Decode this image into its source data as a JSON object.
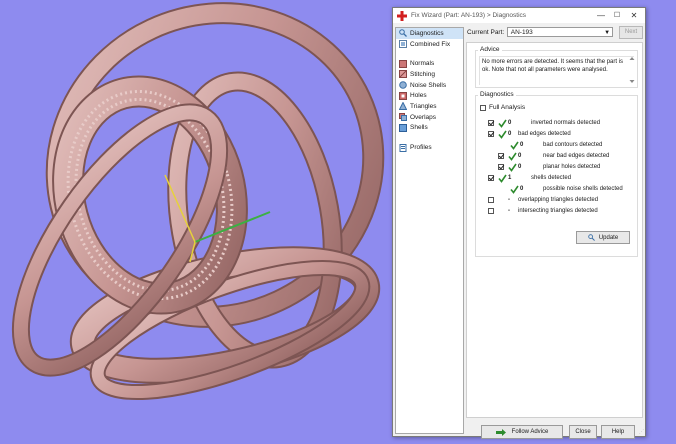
{
  "window": {
    "title": "Fix Wizard (Part: AN-193) > Diagnostics",
    "min": "—",
    "max": "☐",
    "close": "✕"
  },
  "sidebar": {
    "items": [
      {
        "label": "Diagnostics",
        "icon": "diagnostics-icon"
      },
      {
        "label": "Combined Fix",
        "icon": "combined-fix-icon"
      },
      {
        "label": "Normals",
        "icon": "normals-icon"
      },
      {
        "label": "Stitching",
        "icon": "stitching-icon"
      },
      {
        "label": "Noise Shells",
        "icon": "noise-shells-icon"
      },
      {
        "label": "Holes",
        "icon": "holes-icon"
      },
      {
        "label": "Triangles",
        "icon": "triangles-icon"
      },
      {
        "label": "Overlaps",
        "icon": "overlaps-icon"
      },
      {
        "label": "Shells",
        "icon": "shells-icon"
      },
      {
        "label": "Profiles",
        "icon": "profiles-icon"
      }
    ]
  },
  "current_part": {
    "label": "Current Part:",
    "value": "AN-193",
    "next": "Next"
  },
  "advice": {
    "label": "Advice",
    "text": "No more errors are detected. It seems that the part is ok. Note that not all parameters were analysed."
  },
  "diagnostics": {
    "label": "Diagnostics",
    "full_analysis": "Full Analysis",
    "rows": [
      {
        "count": "0",
        "label": "inverted normals detected"
      },
      {
        "count": "0",
        "label": "bad edges detected"
      },
      {
        "count": "0",
        "label": "bad contours detected"
      },
      {
        "count": "0",
        "label": "near bad edges detected"
      },
      {
        "count": "0",
        "label": "planar holes detected"
      },
      {
        "count": "1",
        "label": "shells detected"
      },
      {
        "count": "0",
        "label": "possible noise shells detected"
      },
      {
        "count": "-",
        "label": "overlapping triangles detected"
      },
      {
        "count": "-",
        "label": "intersecting triangles detected"
      }
    ],
    "update": "Update"
  },
  "buttons": {
    "follow_advice": "Follow Advice",
    "close": "Close",
    "help": "Help"
  },
  "colors": {
    "viewport_bg": "#8E8BEF",
    "model": "#C99B98",
    "check_green": "#2E8B2E",
    "selection": "#CFE3F7"
  }
}
